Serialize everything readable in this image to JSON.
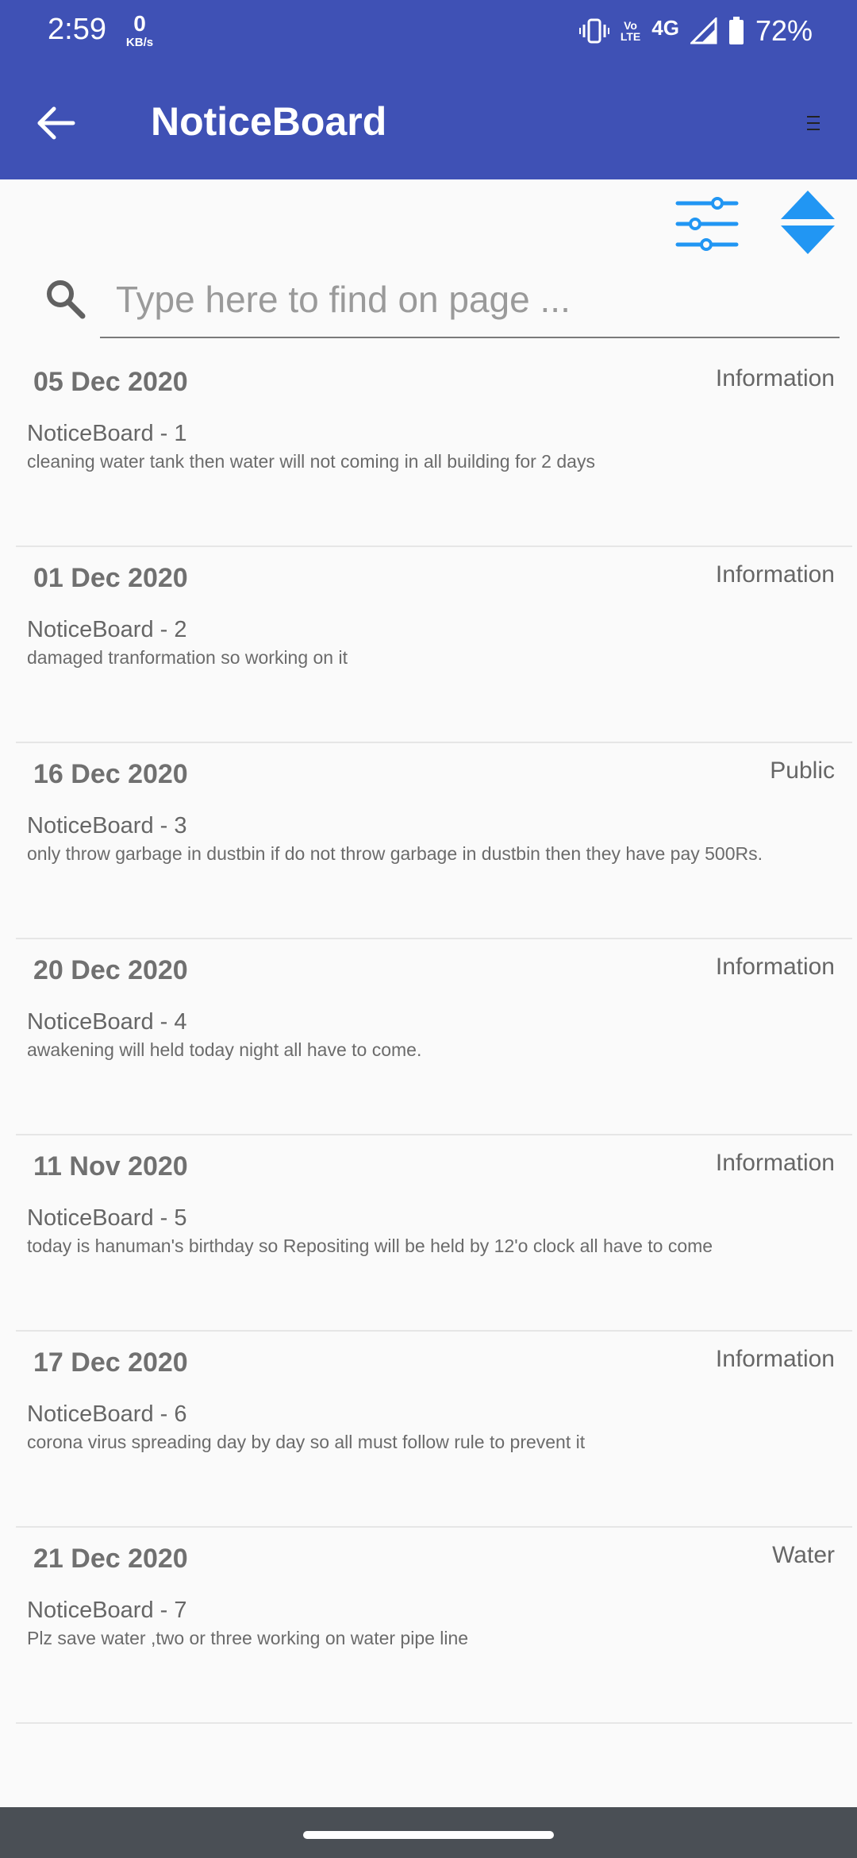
{
  "status_bar": {
    "time": "2:59",
    "net_speed_value": "0",
    "net_speed_unit": "KB/s",
    "network_label_top": "Vo",
    "network_label_bottom": "LTE",
    "network_type": "4G",
    "battery": "72%"
  },
  "app_bar": {
    "title": "NoticeBoard",
    "back_icon": "arrow-left-icon",
    "menu_icon": "menu-icon",
    "color": "#3f51b5"
  },
  "toolbar": {
    "filter_icon": "sliders-icon",
    "sort_icon": "sort-updown-icon",
    "accent": "#2196f3"
  },
  "search": {
    "placeholder": "Type here to find on page ..."
  },
  "notices": [
    {
      "date": "05 Dec 2020",
      "category": "Information",
      "title": "NoticeBoard - 1",
      "description": "cleaning water tank then water will not coming in all building for 2 days"
    },
    {
      "date": "01 Dec 2020",
      "category": "Information",
      "title": "NoticeBoard - 2",
      "description": "damaged tranformation so working on it"
    },
    {
      "date": "16 Dec 2020",
      "category": "Public",
      "title": "NoticeBoard - 3",
      "description": "only throw garbage in dustbin if do not throw garbage in dustbin then they have pay 500Rs."
    },
    {
      "date": "20 Dec 2020",
      "category": "Information",
      "title": "NoticeBoard - 4",
      "description": "awakening will held today night all have to come."
    },
    {
      "date": "11 Nov 2020",
      "category": "Information",
      "title": "NoticeBoard - 5",
      "description": "today is hanuman's birthday so Repositing will be held by 12'o clock all have to come"
    },
    {
      "date": "17 Dec 2020",
      "category": "Information",
      "title": "NoticeBoard - 6",
      "description": "corona virus spreading day by day so all  must follow rule to prevent it"
    },
    {
      "date": "21 Dec 2020",
      "category": "Water",
      "title": "NoticeBoard - 7",
      "description": "Plz save water ,two or three working on water pipe line"
    }
  ]
}
